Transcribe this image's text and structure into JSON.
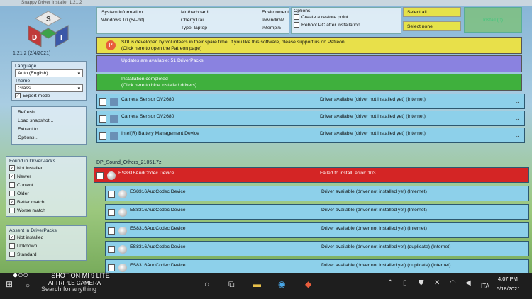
{
  "window": {
    "title": "Snappy Driver Installer 1.21.2"
  },
  "logo": {
    "letters": [
      "S",
      "D",
      "I"
    ],
    "version": "1.21.2 (2/4/2021)"
  },
  "sidebar": {
    "language_label": "Language",
    "language_value": "Auto (English)",
    "theme_label": "Theme",
    "theme_value": "Grass",
    "expert_mode": "Expert mode",
    "buttons": [
      "Refresh",
      "Load snapshot...",
      "Extract to...",
      "Options..."
    ],
    "found_label": "Found in DriverPacks",
    "found": [
      {
        "label": "Not installed",
        "checked": true
      },
      {
        "label": "Newer",
        "checked": true
      },
      {
        "label": "Current",
        "checked": false
      },
      {
        "label": "Older",
        "checked": false
      },
      {
        "label": "Better match",
        "checked": true
      },
      {
        "label": "Worse match",
        "checked": false
      }
    ],
    "absent_label": "Absent in DriverPacks",
    "absent": [
      {
        "label": "Not installed",
        "checked": true
      },
      {
        "label": "Unknown",
        "checked": false
      },
      {
        "label": "Standard",
        "checked": false
      }
    ]
  },
  "sysinfo": {
    "h1": "System information",
    "v1": "Windows 10 (64-bit)",
    "h2": "Motherboard",
    "v2a": "CherryTrail",
    "v2b": "Type: laptop",
    "h3": "Environment",
    "v3a": "%windir%\\",
    "v3b": "%temp%"
  },
  "options": {
    "title": "Options",
    "restore": "Create a restore point",
    "reboot": "Reboot PC after installation"
  },
  "actions": {
    "select_all": "Select all",
    "select_none": "Select none",
    "install": "Install (0)"
  },
  "banners": {
    "patreon_l1": "SDI is developed by volunteers in their spare time. If you like this software, please support us on Patreon.",
    "patreon_l2": "(Click here to open the Patreon page)",
    "updates_l1": "Updates are available: 51 DriverPacks",
    "install_l1": "Installation completed",
    "install_l2": "(Click here to hide installed drivers)"
  },
  "devices": [
    {
      "name": "Camera Sensor OV2680",
      "status": "Driver available (driver not installed yet) (Internet)"
    },
    {
      "name": "Camera Sensor OV2680",
      "status": "Driver available (driver not installed yet) (Internet)"
    },
    {
      "name": "Intel(R) Battery Management Device",
      "status": "Driver available (driver not installed yet) (Internet)"
    }
  ],
  "pack_name": "DP_Sound_Others_21051.7z",
  "failed": {
    "name": "ES8316AudCodec Device",
    "status": "Failed to install, error: 103"
  },
  "audio": [
    {
      "name": "ES8316AudCodec Device",
      "status": "Driver available (driver not installed yet) (Internet)"
    },
    {
      "name": "ES8316AudCodec Device",
      "status": "Driver available (driver not installed yet) (Internet)"
    },
    {
      "name": "ES8316AudCodec Device",
      "status": "Driver available (driver not installed yet) (Internet)"
    },
    {
      "name": "ES8316AudCodec Device",
      "status": "Driver available (driver not installed yet) (duplicate) (Internet)"
    },
    {
      "name": "ES8316AudCodec Device",
      "status": "Driver available (driver not installed yet) (duplicate) (Internet)"
    }
  ],
  "taskbar": {
    "search": "Search for anything",
    "lang": "ITA",
    "time": "4:07 PM",
    "date": "5/18/2021"
  },
  "camera": {
    "line1": "SHOT ON MI 9 LITE",
    "line2": "AI TRIPLE CAMERA"
  }
}
